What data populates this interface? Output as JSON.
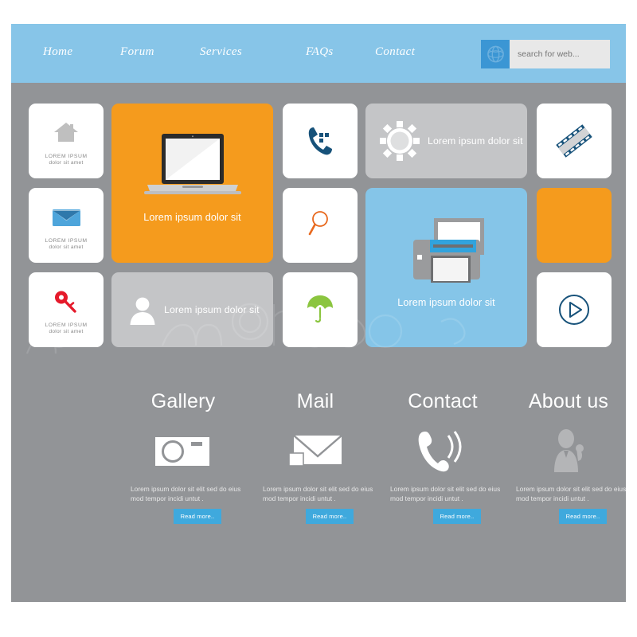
{
  "header": {
    "nav": [
      {
        "label": "Home"
      },
      {
        "label": "Forum"
      },
      {
        "label": "Services"
      },
      {
        "label": "FAQs"
      },
      {
        "label": "Contact"
      }
    ],
    "search": {
      "placeholder": "search for web...",
      "icon": "globe-icon",
      "button_bg": "#3b96d4"
    },
    "bg": "#87c5e8"
  },
  "colors": {
    "page_bg": "#929497",
    "tile_white": "#ffffff",
    "tile_orange": "#f59b1d",
    "tile_gray": "#c4c5c7",
    "tile_blue": "#85c5e8",
    "accent_blue": "#3fa9dd",
    "icon_navy": "#17527a"
  },
  "tiles": {
    "small_caption_line1": "LOREM IPSUM",
    "small_caption_line2": "dolor sit amet",
    "items": [
      {
        "name": "home-tile",
        "icon": "house-icon",
        "style": "white",
        "caption": ""
      },
      {
        "name": "mail-tile",
        "icon": "envelope-icon",
        "style": "white",
        "caption": ""
      },
      {
        "name": "key-tile",
        "icon": "key-icon",
        "style": "white",
        "caption": ""
      },
      {
        "name": "laptop-tile",
        "icon": "laptop-icon",
        "style": "orange",
        "caption": "Lorem ipsum dolor sit"
      },
      {
        "name": "user-tile",
        "icon": "user-icon",
        "style": "gray",
        "caption": "Lorem ipsum dolor sit"
      },
      {
        "name": "phone-tile",
        "icon": "phone-icon",
        "style": "white",
        "caption": ""
      },
      {
        "name": "search-tile",
        "icon": "magnifier-icon",
        "style": "white",
        "caption": ""
      },
      {
        "name": "umbrella-tile",
        "icon": "umbrella-icon",
        "style": "white",
        "caption": ""
      },
      {
        "name": "settings-tile",
        "icon": "gear-icon",
        "style": "gray",
        "caption": "Lorem ipsum dolor sit"
      },
      {
        "name": "printer-tile",
        "icon": "printer-icon",
        "style": "blue",
        "caption": "Lorem ipsum dolor sit"
      },
      {
        "name": "film-tile",
        "icon": "film-strip-icon",
        "style": "white",
        "caption": ""
      },
      {
        "name": "blank-tile",
        "icon": "",
        "style": "orange",
        "caption": ""
      },
      {
        "name": "play-tile",
        "icon": "play-circle-icon",
        "style": "white",
        "caption": ""
      }
    ]
  },
  "features": {
    "body_text": "Lorem ipsum dolor sit elit sed do eius mod tempor incidi untut .",
    "read_more_label": "Read more..",
    "items": [
      {
        "title": "Gallery",
        "icon": "camera-icon"
      },
      {
        "title": "Mail",
        "icon": "envelope-icon"
      },
      {
        "title": "Contact",
        "icon": "ringing-phone-icon"
      },
      {
        "title": "About us",
        "icon": "person-icon"
      }
    ]
  }
}
